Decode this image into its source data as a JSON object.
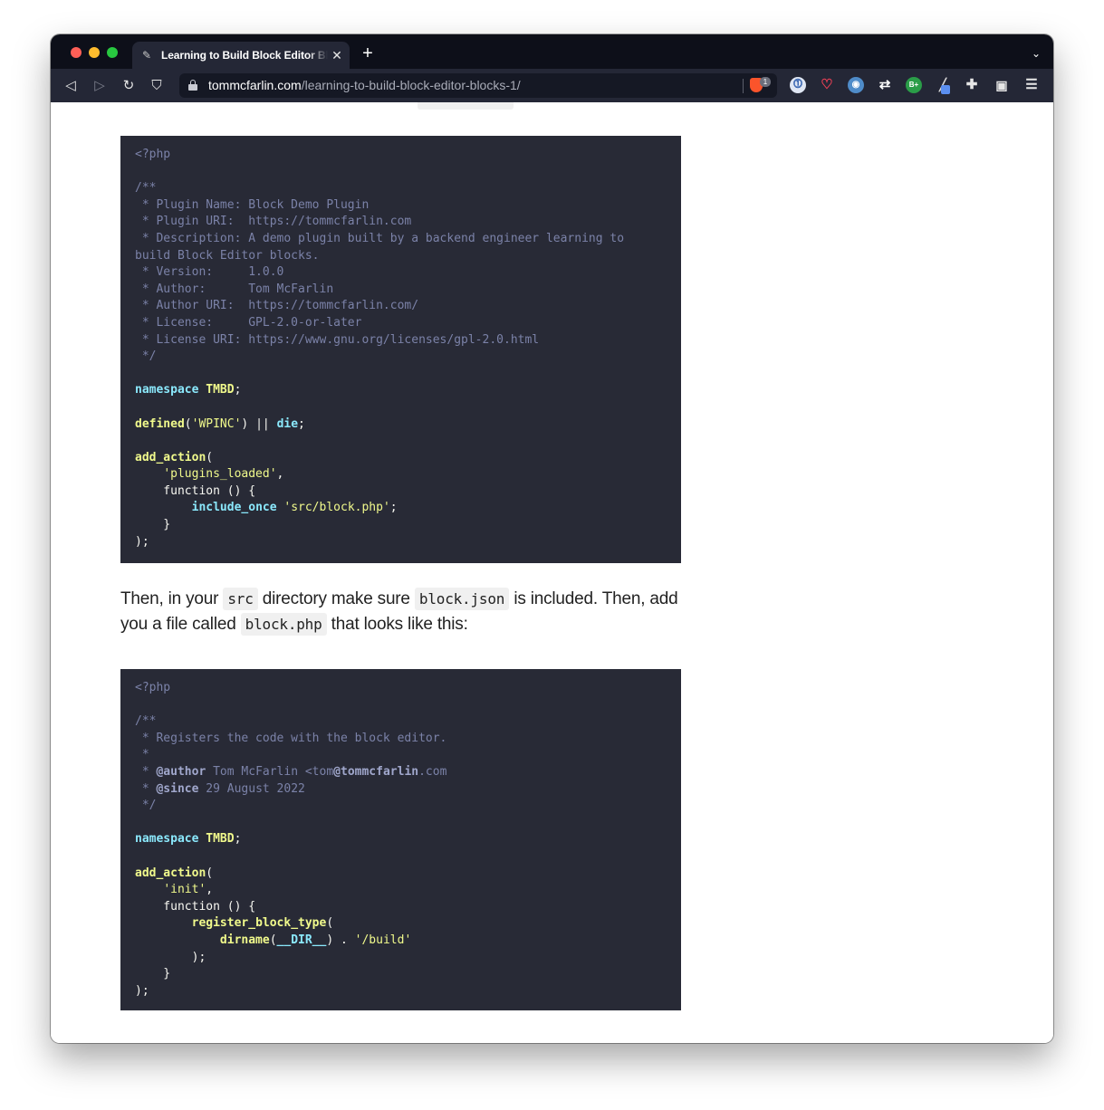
{
  "browser": {
    "tab_title": "Learning to Build Block Editor Blocks",
    "url_host": "tommcfarlin.com",
    "url_path": "/learning-to-build-block-editor-blocks-1/",
    "shield_count": "1",
    "icons": [
      "back-icon",
      "forward-icon",
      "reload-icon",
      "bookmark-icon",
      "lock-icon",
      "brave-shield-icon",
      "onepassword-icon",
      "pocket-icon",
      "extension-icon",
      "sync-icon",
      "grammarly-icon",
      "pen-icon",
      "puzzle-icon",
      "wallet-icon",
      "menu-icon"
    ]
  },
  "code_block_1": {
    "language": "php",
    "lines": [
      "<?php",
      "",
      "/**",
      " * Plugin Name: Block Demo Plugin",
      " * Plugin URI:  https://tommcfarlin.com",
      " * Description: A demo plugin built by a backend engineer learning to",
      "build Block Editor blocks.",
      " * Version:     1.0.0",
      " * Author:      Tom McFarlin",
      " * Author URI:  https://tommcfarlin.com/",
      " * License:     GPL-2.0-or-later",
      " * License URI: https://www.gnu.org/licenses/gpl-2.0.html",
      " */",
      "",
      "namespace TMBD;",
      "",
      "defined('WPINC') || die;",
      "",
      "add_action(",
      "    'plugins_loaded',",
      "    function () {",
      "        include_once 'src/block.php';",
      "    }",
      ");"
    ]
  },
  "paragraph": {
    "t1": "Then, in your ",
    "c1": "src",
    "t2": " directory make sure ",
    "c2": "block.json",
    "t3": " is included. Then, add you a file called ",
    "c3": "block.php",
    "t4": " that looks like this:"
  },
  "code_block_2": {
    "language": "php",
    "lines": [
      "<?php",
      "",
      "/**",
      " * Registers the code with the block editor.",
      " *",
      " * @author Tom McFarlin <tom@tommcfarlin.com",
      " * @since 29 August 2022",
      " */",
      "",
      "namespace TMBD;",
      "",
      "add_action(",
      "    'init',",
      "    function () {",
      "        register_block_type(",
      "            dirname(__DIR__) . '/build'",
      "        );",
      "    }",
      ");"
    ]
  },
  "colors": {
    "code_bg": "#282a36",
    "comment": "#7b82a8",
    "keyword": "#8be9fd",
    "function": "#f1fa8c",
    "string": "#f1fa8c",
    "tab_bar_bg": "#0d0f19",
    "toolbar_bg": "#242736"
  }
}
